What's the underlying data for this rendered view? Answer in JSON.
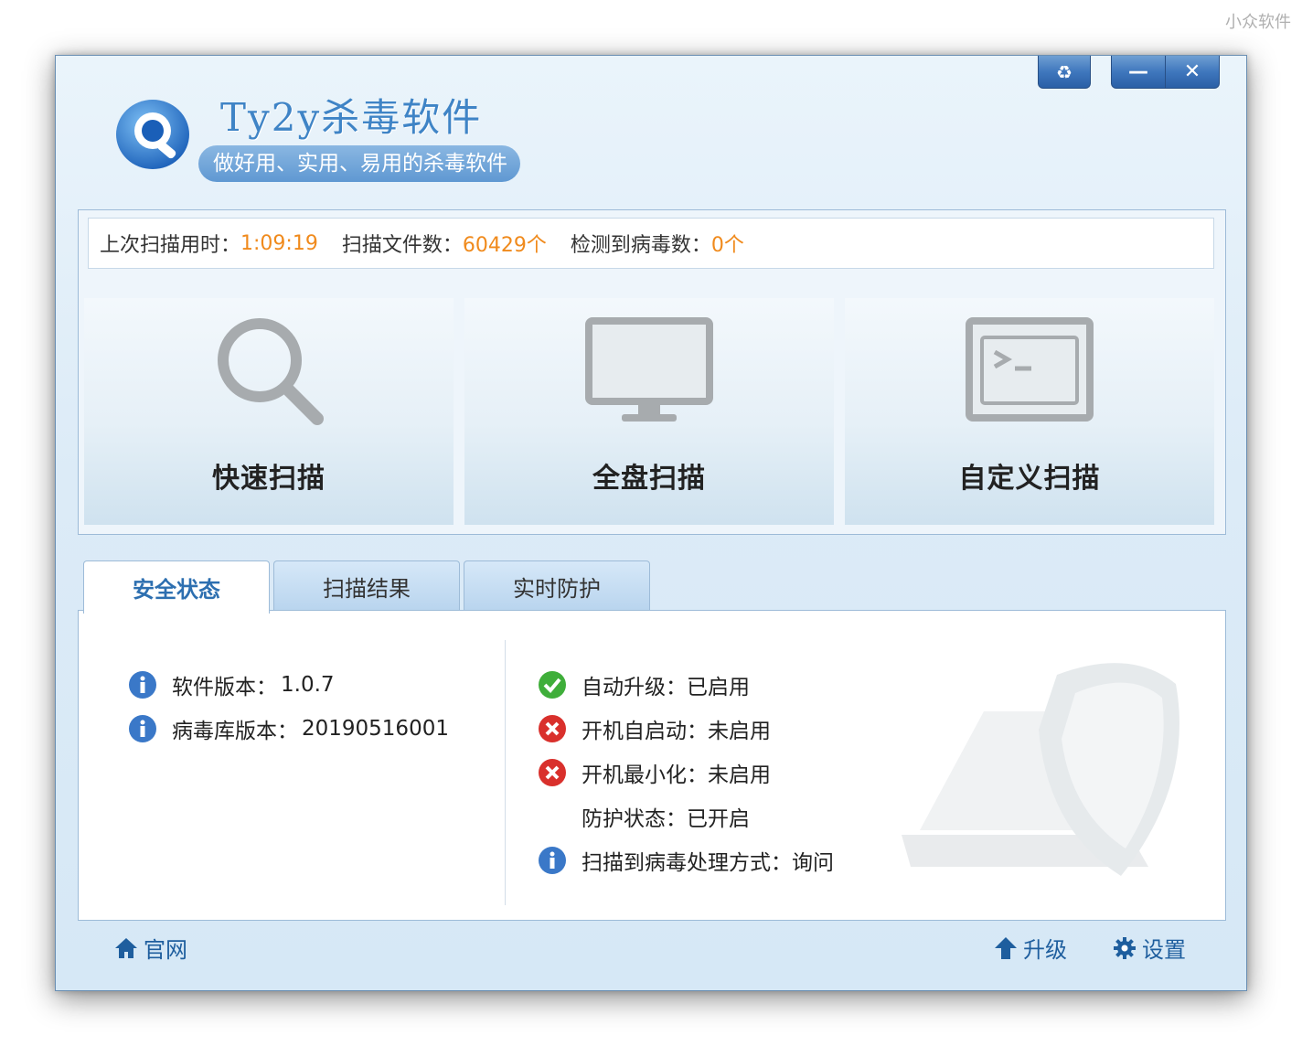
{
  "watermark": "小众软件",
  "app": {
    "title": "Ty2y杀毒软件",
    "slogan": "做好用、实用、易用的杀毒软件"
  },
  "window_controls": {
    "refresh": "♻",
    "minimize": "—",
    "close": "✕"
  },
  "stats": {
    "last_scan_label": "上次扫描用时：",
    "last_scan_value": "1:09:19",
    "files_label": "扫描文件数：",
    "files_value": "60429个",
    "virus_label": "检测到病毒数：",
    "virus_value": "0个",
    "value_color": "#f08a1c"
  },
  "scan_buttons": {
    "quick": "快速扫描",
    "full": "全盘扫描",
    "custom": "自定义扫描"
  },
  "tabs": [
    {
      "label": "安全状态",
      "active": true
    },
    {
      "label": "扫描结果",
      "active": false
    },
    {
      "label": "实时防护",
      "active": false
    }
  ],
  "status": {
    "left": [
      {
        "icon": "info-icon",
        "label": "软件版本：",
        "value": "1.0.7"
      },
      {
        "icon": "info-icon",
        "label": "病毒库版本：",
        "value": "20190516001"
      }
    ],
    "right": [
      {
        "icon": "check-icon",
        "label": "自动升级：",
        "value": "已启用"
      },
      {
        "icon": "error-icon",
        "label": "开机自启动：",
        "value": "未启用"
      },
      {
        "icon": "error-icon",
        "label": "开机最小化：",
        "value": "未启用"
      },
      {
        "icon": "",
        "label": "防护状态：",
        "value": "已开启"
      },
      {
        "icon": "info-icon",
        "label": "扫描到病毒处理方式：",
        "value": "询问"
      }
    ]
  },
  "footer": {
    "home": "官网",
    "upgrade": "升级",
    "settings": "设置"
  },
  "colors": {
    "accent": "#3f84c6",
    "link": "#1e5e9e"
  }
}
